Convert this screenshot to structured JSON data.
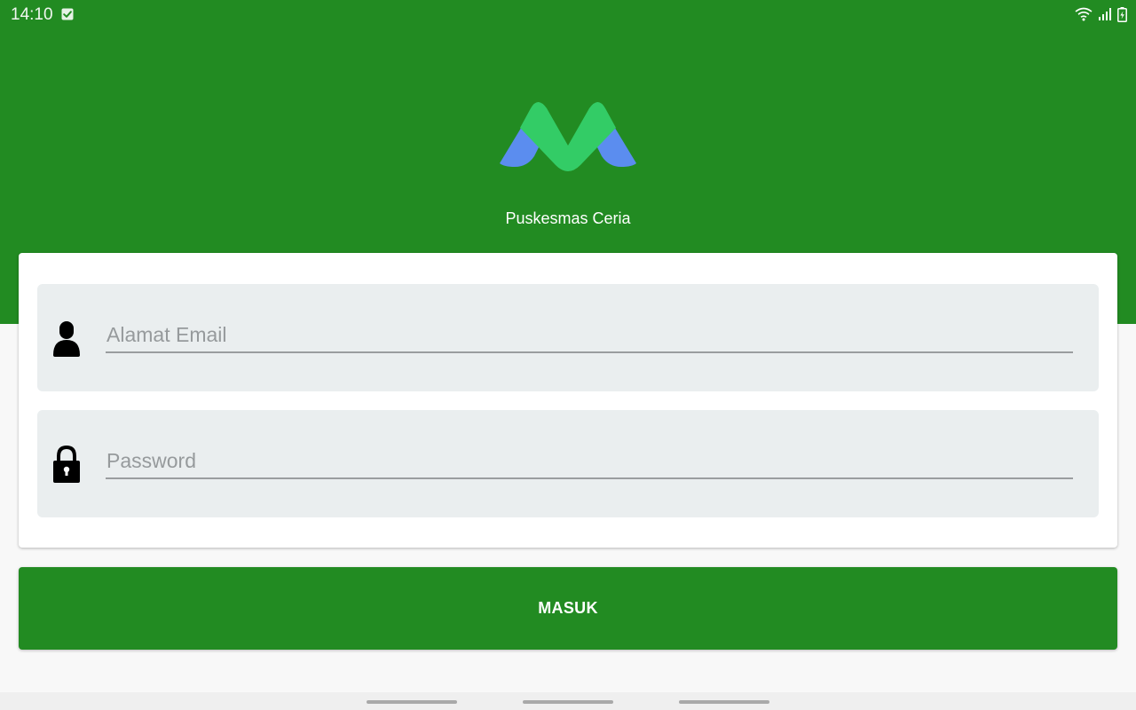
{
  "status_bar": {
    "time": "14:10",
    "notification_icon": "check-square-icon",
    "wifi_icon": "wifi-icon",
    "signal_icon": "signal-icon",
    "battery_icon": "battery-charging-icon"
  },
  "header": {
    "logo_icon": "m-logo-icon",
    "app_name": "Puskesmas Ceria"
  },
  "login_form": {
    "email_field": {
      "icon": "user-icon",
      "placeholder": "Alamat Email",
      "value": ""
    },
    "password_field": {
      "icon": "lock-icon",
      "placeholder": "Password",
      "value": ""
    },
    "submit_label": "MASUK"
  },
  "nav_bar": {
    "handles": [
      "back-handle",
      "home-handle",
      "recents-handle"
    ]
  },
  "colors": {
    "primary_green": "#228b22",
    "field_background": "#eaeeef",
    "logo_green": "#33cc66",
    "logo_blue": "#5b8def",
    "page_background": "#f8f8f8"
  }
}
